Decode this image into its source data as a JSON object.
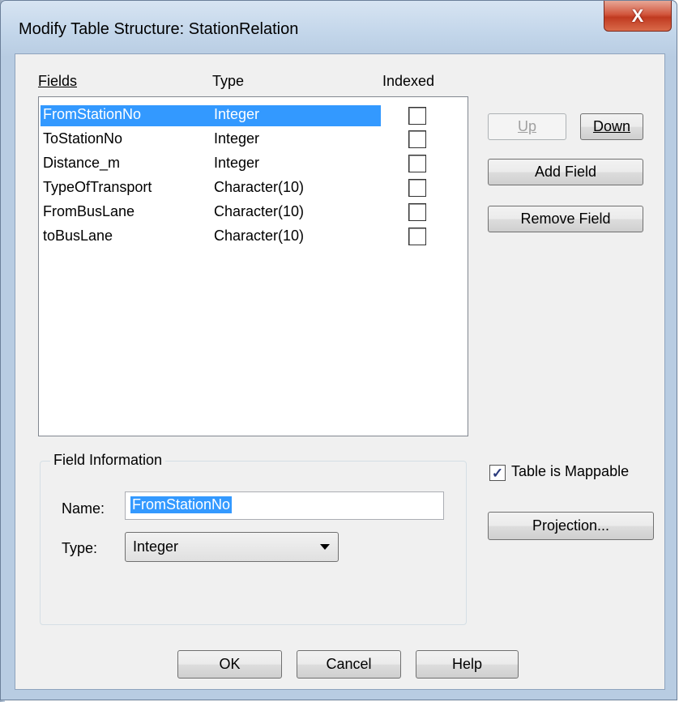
{
  "window": {
    "title": "Modify Table Structure: StationRelation",
    "close_glyph": "X"
  },
  "fields": {
    "headers": {
      "fields": "Fields",
      "type": "Type",
      "indexed": "Indexed"
    },
    "rows": [
      {
        "name": "FromStationNo",
        "type": "Integer",
        "indexed": false,
        "selected": true
      },
      {
        "name": "ToStationNo",
        "type": "Integer",
        "indexed": false,
        "selected": false
      },
      {
        "name": "Distance_m",
        "type": "Integer",
        "indexed": false,
        "selected": false
      },
      {
        "name": "TypeOfTransport",
        "type": "Character(10)",
        "indexed": false,
        "selected": false
      },
      {
        "name": "FromBusLane",
        "type": "Character(10)",
        "indexed": false,
        "selected": false
      },
      {
        "name": "toBusLane",
        "type": "Character(10)",
        "indexed": false,
        "selected": false
      }
    ]
  },
  "buttons": {
    "up": "Up",
    "down": "Down",
    "add_field": "Add Field",
    "remove_field": "Remove Field",
    "projection": "Projection...",
    "ok": "OK",
    "cancel": "Cancel",
    "help": "Help"
  },
  "field_info": {
    "legend": "Field Information",
    "name_label": "Name:",
    "name_value": "FromStationNo",
    "type_label": "Type:",
    "type_value": "Integer"
  },
  "mappable": {
    "label": "Table is Mappable",
    "checked": true,
    "check_glyph": "✓"
  }
}
